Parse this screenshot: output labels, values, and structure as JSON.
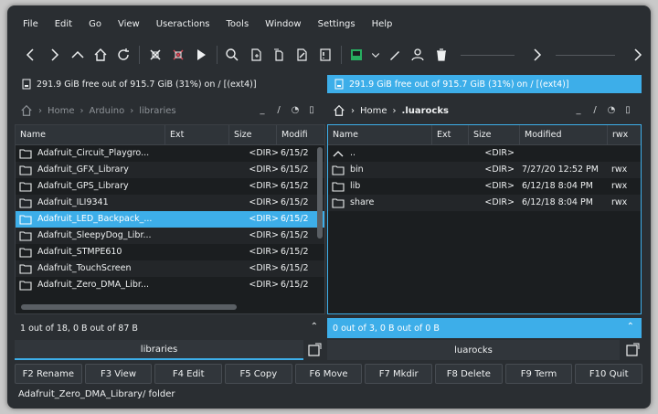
{
  "menu": [
    "File",
    "Edit",
    "Go",
    "View",
    "Useractions",
    "Tools",
    "Window",
    "Settings",
    "Help"
  ],
  "toolbar": {
    "icons": [
      "back-icon",
      "forward-icon",
      "up-icon",
      "home-icon",
      "refresh-icon",
      "compare-icon",
      "sync-icon",
      "run-icon",
      "search-icon",
      "new-file-icon",
      "copy-file-icon",
      "edit-file-icon",
      "view-file-icon",
      "terminal-icon",
      "dropdown-icon",
      "pen-icon",
      "user-icon",
      "trash-icon",
      "next-icon",
      "last-icon"
    ]
  },
  "left": {
    "disk_info": "291.9 GiB free out of 915.7 GiB (31%) on / [(ext4)]",
    "path": [
      "Home",
      "Arduino",
      "libraries"
    ],
    "path_ctrls": [
      "_",
      "/",
      "◔",
      "▯"
    ],
    "columns": [
      "Name",
      "Ext",
      "Size",
      "Modifi"
    ],
    "rows": [
      {
        "name": "Adafruit_Circuit_Playgro...",
        "size": "<DIR>",
        "modified": "6/15/2"
      },
      {
        "name": "Adafruit_GFX_Library",
        "size": "<DIR>",
        "modified": "6/15/2"
      },
      {
        "name": "Adafruit_GPS_Library",
        "size": "<DIR>",
        "modified": "6/15/2"
      },
      {
        "name": "Adafruit_ILI9341",
        "size": "<DIR>",
        "modified": "6/15/2"
      },
      {
        "name": "Adafruit_LED_Backpack_...",
        "size": "<DIR>",
        "modified": "6/15/2"
      },
      {
        "name": "Adafruit_SleepyDog_Libr...",
        "size": "<DIR>",
        "modified": "6/15/2"
      },
      {
        "name": "Adafruit_STMPE610",
        "size": "<DIR>",
        "modified": "6/15/2"
      },
      {
        "name": "Adafruit_TouchScreen",
        "size": "<DIR>",
        "modified": "6/15/2"
      },
      {
        "name": "Adafruit_Zero_DMA_Libr...",
        "size": "<DIR>",
        "modified": "6/15/2"
      }
    ],
    "selected_index": 4,
    "status": "1 out of 18, 0 B out of 87 B",
    "tab_label": "libraries"
  },
  "right": {
    "disk_info": "291.9 GiB free out of 915.7 GiB (31%) on / [(ext4)]",
    "path": [
      "Home",
      ".luarocks"
    ],
    "path_ctrls": [
      "_",
      "/",
      "◔",
      "▯"
    ],
    "columns": [
      "Name",
      "Ext",
      "Size",
      "Modified",
      "rwx"
    ],
    "rows": [
      {
        "name": "..",
        "size": "<DIR>",
        "modified": "",
        "rwx": ""
      },
      {
        "name": "bin",
        "size": "<DIR>",
        "modified": "7/27/20 12:52 PM",
        "rwx": "rwx"
      },
      {
        "name": "lib",
        "size": "<DIR>",
        "modified": "6/12/18 8:04 PM",
        "rwx": "rwx"
      },
      {
        "name": "share",
        "size": "<DIR>",
        "modified": "6/12/18 8:04 PM",
        "rwx": "rwx"
      }
    ],
    "status": "0 out of 3, 0 B out of 0 B",
    "tab_label": "luarocks"
  },
  "fkeys": [
    "F2 Rename",
    "F3 View",
    "F4 Edit",
    "F5 Copy",
    "F6 Move",
    "F7 Mkdir",
    "F8 Delete",
    "F9 Term",
    "F10 Quit"
  ],
  "bottom_status": "Adafruit_Zero_DMA_Library/  folder",
  "colors": {
    "accent": "#3daee9",
    "window_bg": "#2a2e32",
    "panel_bg": "#1b1e20"
  }
}
